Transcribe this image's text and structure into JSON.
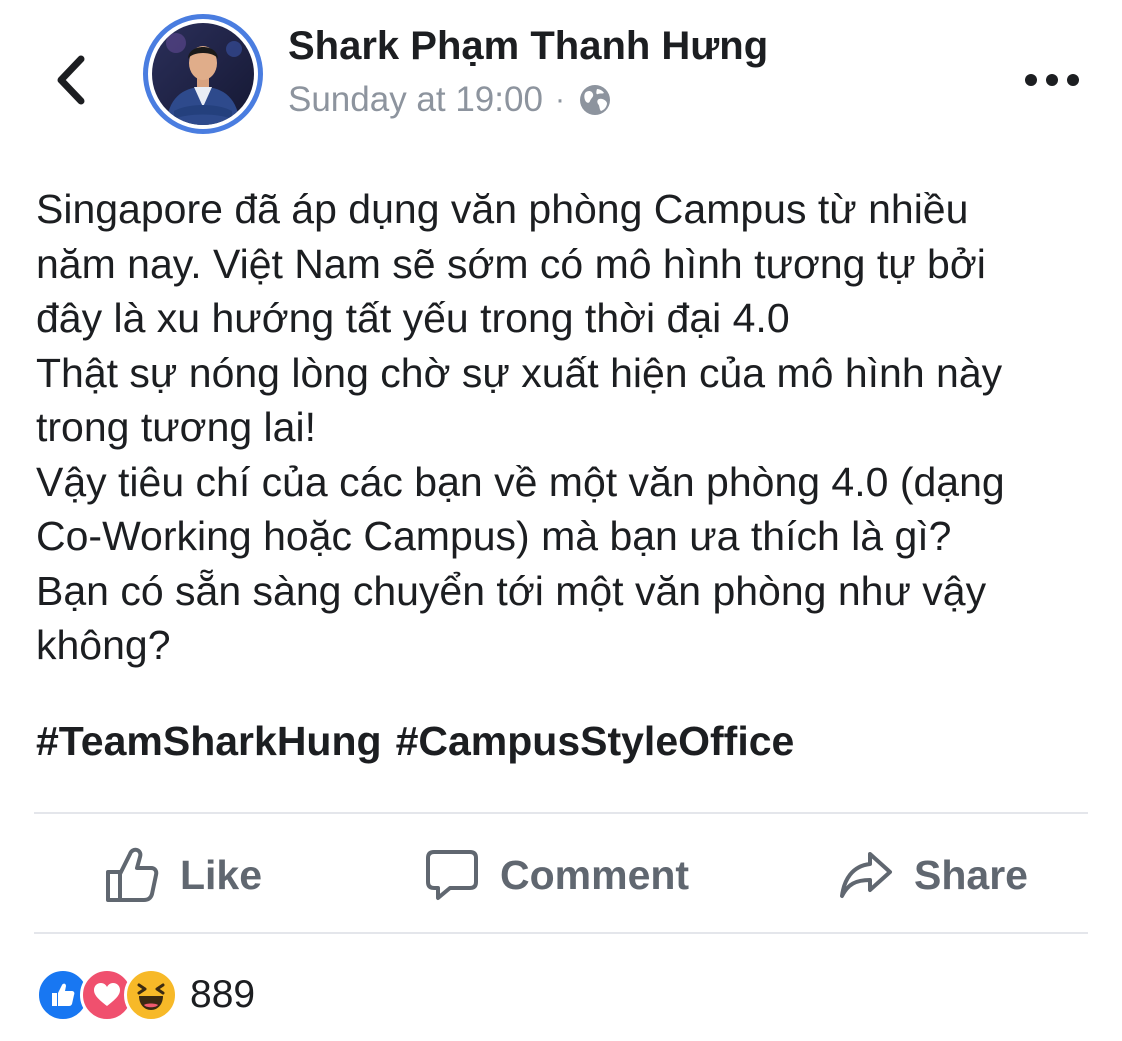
{
  "header": {
    "author_name": "Shark Phạm Thanh Hưng",
    "timestamp": "Sunday at 19:00",
    "separator": "·",
    "audience_icon": "globe-icon",
    "back_icon": "chevron-left-icon",
    "more_icon": "more-horizontal-icon"
  },
  "post": {
    "lines": [
      "Singapore đã áp dụng văn phòng Campus từ nhiều",
      "năm nay. Việt Nam sẽ sớm có mô hình tương tự bởi",
      "đây là xu hướng tất yếu trong thời đại 4.0",
      "Thật sự nóng lòng chờ sự xuất hiện của mô hình này",
      "trong tương lai!",
      "Vậy tiêu chí của các bạn về một văn phòng 4.0 (dạng",
      "Co-Working hoặc Campus) mà bạn  ưa thích là gì?",
      "Bạn có sẵn sàng chuyển tới một văn phòng như vậy",
      "không?"
    ],
    "hashtags": [
      "#TeamSharkHung",
      "#CampusStyleOffice"
    ]
  },
  "actions": {
    "like_label": "Like",
    "comment_label": "Comment",
    "share_label": "Share"
  },
  "reactions": {
    "types": [
      "like",
      "love",
      "haha"
    ],
    "count": "889"
  },
  "colors": {
    "accent": "#4a7de0",
    "like_blue": "#1877f2",
    "love_red": "#f0506e",
    "haha_yellow": "#f7b928",
    "muted": "#8d949e",
    "action_gray": "#606770",
    "divider": "#e4e6eb"
  }
}
